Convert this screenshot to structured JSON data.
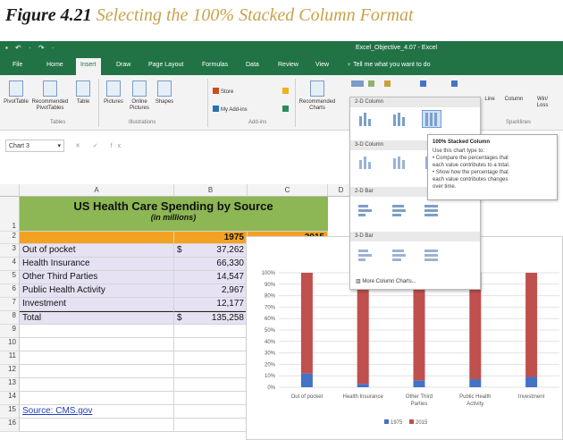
{
  "caption": {
    "figure": "Figure 4.21",
    "title": "Selecting the 100% Stacked Column Format"
  },
  "window": {
    "quick_access": "▪ ↶ · ↷ ·",
    "title": "Excel_Objective_4.07 - Excel"
  },
  "tabs": [
    "File",
    "Home",
    "Insert",
    "Draw",
    "Page Layout",
    "Formulas",
    "Data",
    "Review",
    "View"
  ],
  "tell_me": "Tell me what you want to do",
  "ribbon": {
    "pivottable": "PivotTable",
    "recommended_pivottables": "Recommended PivotTables",
    "table": "Table",
    "tables_group": "Tables",
    "pictures": "Pictures",
    "online_pictures": "Online Pictures",
    "shapes": "Shapes",
    "illustrations_group": "Illustrations",
    "store": "Store",
    "my_addins": "My Add-ins",
    "addins_group": "Add-ins",
    "recommended_charts": "Recommended Charts",
    "spark_line": "Line",
    "spark_column": "Column",
    "spark_winloss": "Win/ Loss",
    "sparklines_group": "Sparklines"
  },
  "name_box": "Chart 3",
  "formula_icons": "✕ ✓ fx",
  "columns": [
    "A",
    "B",
    "C",
    "D"
  ],
  "rows": [
    "1",
    "2",
    "3",
    "4",
    "5",
    "6",
    "7",
    "8",
    "9",
    "10",
    "11",
    "12",
    "13",
    "14",
    "15",
    "16"
  ],
  "sheet": {
    "title": "US Health Care Spending by Source",
    "subtitle": "(in millions)",
    "header_b": "1975",
    "header_c": "2015",
    "items": [
      {
        "label": "Out of pocket",
        "dollar": "$",
        "value": "37,262"
      },
      {
        "label": "Health Insurance",
        "dollar": "",
        "value": "66,330"
      },
      {
        "label": "Other Third Parties",
        "dollar": "",
        "value": "14,547"
      },
      {
        "label": "Public Health Activity",
        "dollar": "",
        "value": "2,967"
      },
      {
        "label": "Investment",
        "dollar": "",
        "value": "12,177"
      }
    ],
    "total_label": "Total",
    "total_dollar": "$",
    "total_value": "135,258",
    "source_link": "Source: CMS.gov"
  },
  "chart_data": {
    "type": "bar",
    "stacked": "percent",
    "categories": [
      "Out of pocket",
      "Health Insurance",
      "Other Third Parties",
      "Public Health Activity",
      "Investment"
    ],
    "category_lines": [
      [
        "Out of pocket"
      ],
      [
        "Health Insurance"
      ],
      [
        "Other Third",
        "Parties"
      ],
      [
        "Public Health",
        "Activity"
      ],
      [
        "Investment"
      ]
    ],
    "series": [
      {
        "name": "1975",
        "color": "#4472c4",
        "values": [
          12,
          3,
          6,
          7,
          9
        ]
      },
      {
        "name": "2015",
        "color": "#c0504d",
        "values": [
          88,
          97,
          94,
          93,
          91
        ]
      }
    ],
    "yticks": [
      "0%",
      "10%",
      "20%",
      "30%",
      "40%",
      "50%",
      "60%",
      "70%",
      "80%",
      "90%",
      "100%"
    ],
    "ylim": [
      0,
      100
    ],
    "legend_position": "bottom"
  },
  "dropdown": {
    "section_2d_column": "2-D Column",
    "section_3d_column": "3-D Column",
    "section_2d_bar": "2-D Bar",
    "section_3d_bar": "3-D Bar",
    "more_column_charts": "More Column Charts..."
  },
  "tooltip": {
    "title": "100% Stacked Column",
    "body": [
      "Use this chart type to:",
      "• Compare the percentages that",
      "each value contributes to a total.",
      "• Show how the percentage that",
      "each value contributes changes",
      "over time."
    ]
  }
}
